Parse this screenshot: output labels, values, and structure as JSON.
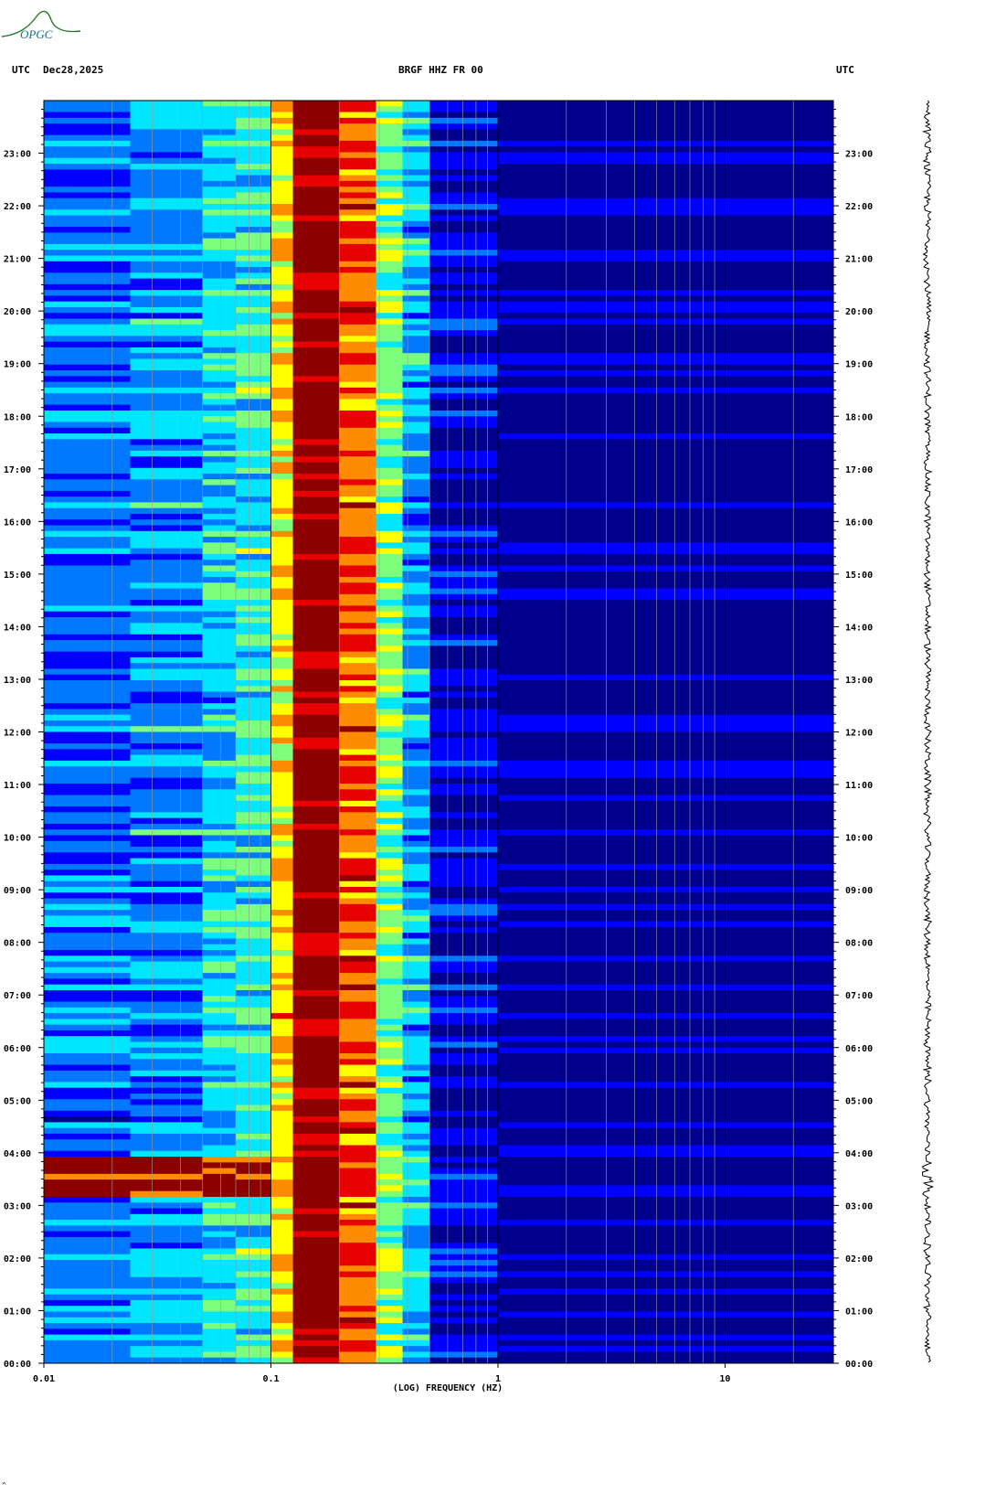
{
  "header": {
    "left_tz": "UTC",
    "date": "Dec28,2025",
    "station": "BRGF HHZ FR 00",
    "right_tz": "UTC"
  },
  "logo": {
    "text": "OPGC",
    "color": "#2a7a2a"
  },
  "footer": {
    "mark": "^"
  },
  "chart_data": {
    "type": "heatmap",
    "title": "BRGF HHZ FR 00",
    "xlabel": "(LOG) FREQUENCY (HZ)",
    "x_scale": "log",
    "xlim": [
      0.01,
      30
    ],
    "x_ticks": [
      {
        "value": 0.01,
        "label": "0.01"
      },
      {
        "value": 0.1,
        "label": "0.1"
      },
      {
        "value": 1,
        "label": "1"
      },
      {
        "value": 10,
        "label": "10"
      }
    ],
    "y_unit": "UTC hour",
    "ylim": [
      0,
      24
    ],
    "y_ticks": [
      "00:00",
      "01:00",
      "02:00",
      "03:00",
      "04:00",
      "05:00",
      "06:00",
      "07:00",
      "08:00",
      "09:00",
      "10:00",
      "11:00",
      "12:00",
      "13:00",
      "14:00",
      "15:00",
      "16:00",
      "17:00",
      "18:00",
      "19:00",
      "20:00",
      "21:00",
      "22:00",
      "23:00"
    ],
    "grid": true,
    "colormap": [
      "#00008c",
      "#0000ff",
      "#0078ff",
      "#00e6ff",
      "#7dff7d",
      "#ffff00",
      "#ff8c00",
      "#e60000",
      "#8c0000"
    ],
    "frequency_bands": [
      {
        "f_min": 0.01,
        "f_max": 0.024,
        "level": 0.26
      },
      {
        "f_min": 0.024,
        "f_max": 0.05,
        "level": 0.3
      },
      {
        "f_min": 0.05,
        "f_max": 0.07,
        "level": 0.38
      },
      {
        "f_min": 0.07,
        "f_max": 0.1,
        "level": 0.42
      },
      {
        "f_min": 0.1,
        "f_max": 0.125,
        "level": 0.62
      },
      {
        "f_min": 0.125,
        "f_max": 0.2,
        "level": 0.94
      },
      {
        "f_min": 0.2,
        "f_max": 0.29,
        "level": 0.76
      },
      {
        "f_min": 0.29,
        "f_max": 0.38,
        "level": 0.5
      },
      {
        "f_min": 0.38,
        "f_max": 0.5,
        "level": 0.34
      },
      {
        "f_min": 0.5,
        "f_max": 1.0,
        "level": 0.13
      },
      {
        "f_min": 1.0,
        "f_max": 30,
        "level": 0.06
      }
    ],
    "event": {
      "t_start": 3.2,
      "t_end": 3.9,
      "f_min": 0.01,
      "f_max": 0.1,
      "level": 0.97
    }
  }
}
